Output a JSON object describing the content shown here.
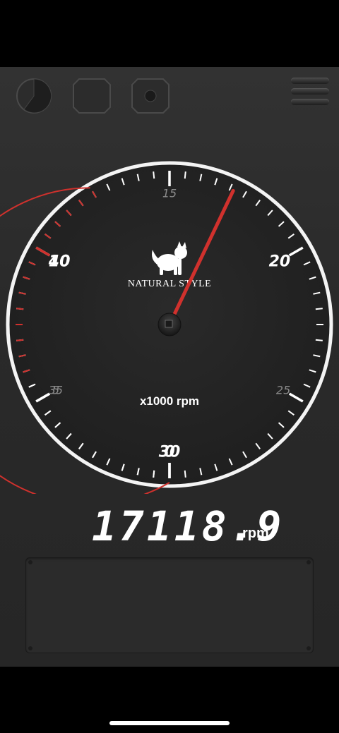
{
  "toolbar": {
    "buttons": [
      {
        "name": "pie-chart-icon"
      },
      {
        "name": "octagon-icon"
      },
      {
        "name": "record-icon"
      }
    ],
    "menu_icon": "hamburger-menu-icon"
  },
  "gauge": {
    "logo_text": "NATURAL STYLE",
    "logo_icon": "cat-icon",
    "unit_label": "x1000 rpm",
    "major_labels": [
      "0",
      "10",
      "20",
      "30",
      "40"
    ],
    "minor_labels": [
      "5",
      "15",
      "25",
      "35"
    ],
    "min": 0,
    "max": 42.5,
    "redline_start": 36,
    "needle_value": 17.1189,
    "colors": {
      "accent": "#d0312d",
      "face": "#242424",
      "tick": "#ffffff",
      "minor_label": "#8a8a8a"
    }
  },
  "readout": {
    "value": "17118.9",
    "unit": "rpm"
  }
}
